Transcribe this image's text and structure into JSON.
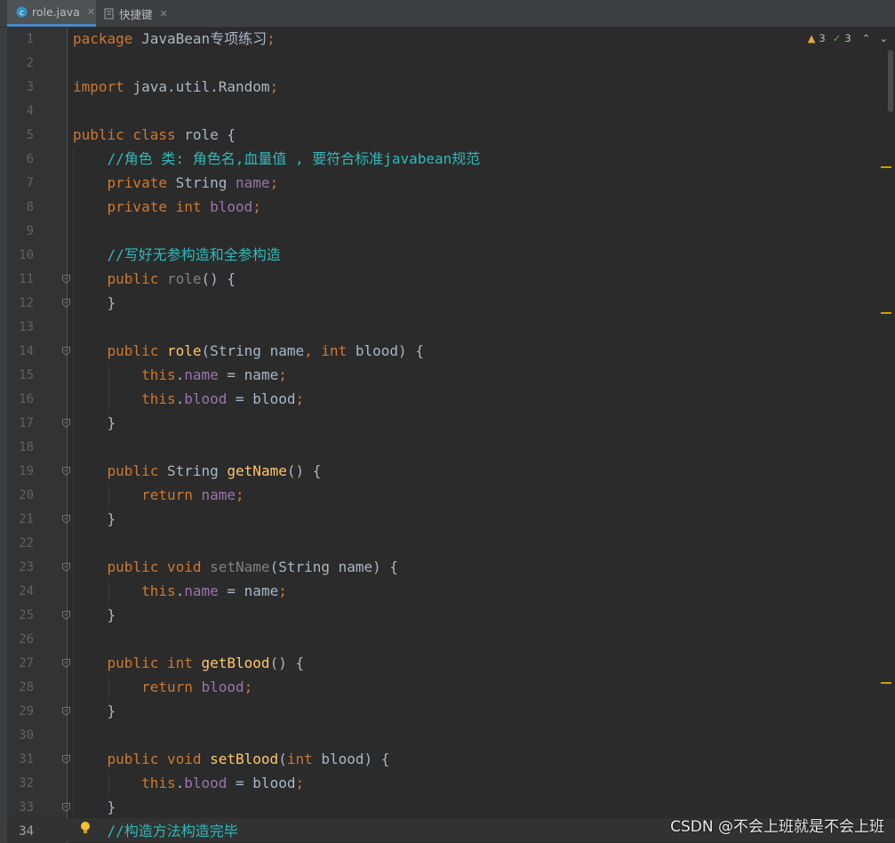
{
  "tabs": [
    {
      "label": "role.java",
      "icon": "java-class-icon",
      "active": true
    },
    {
      "label": "快捷键",
      "icon": "file-icon",
      "active": false
    }
  ],
  "inspections": {
    "warnings": "3",
    "weak_warnings": "3"
  },
  "current_line": 34,
  "code_lines": [
    {
      "n": 1,
      "tokens": [
        [
          "k",
          "package "
        ],
        [
          "p",
          "JavaBean专项练习"
        ],
        [
          "k",
          ";"
        ]
      ]
    },
    {
      "n": 2,
      "tokens": []
    },
    {
      "n": 3,
      "tokens": [
        [
          "k",
          "import "
        ],
        [
          "p",
          "java.util.Random"
        ],
        [
          "k",
          ";"
        ]
      ]
    },
    {
      "n": 4,
      "tokens": []
    },
    {
      "n": 5,
      "tokens": [
        [
          "k",
          "public class "
        ],
        [
          "p",
          "role {"
        ]
      ]
    },
    {
      "n": 6,
      "tokens": [
        [
          "p",
          "    "
        ],
        [
          "c",
          "//角色 类: 角色名,血量值 , 要符合标准javabean规范"
        ]
      ]
    },
    {
      "n": 7,
      "tokens": [
        [
          "p",
          "    "
        ],
        [
          "k",
          "private "
        ],
        [
          "p",
          "String "
        ],
        [
          "f",
          "name"
        ],
        [
          "k",
          ";"
        ]
      ]
    },
    {
      "n": 8,
      "tokens": [
        [
          "p",
          "    "
        ],
        [
          "k",
          "private int "
        ],
        [
          "f",
          "blood"
        ],
        [
          "k",
          ";"
        ]
      ]
    },
    {
      "n": 9,
      "tokens": []
    },
    {
      "n": 10,
      "tokens": [
        [
          "p",
          "    "
        ],
        [
          "c",
          "//写好无参构造和全参构造"
        ]
      ]
    },
    {
      "n": 11,
      "tokens": [
        [
          "p",
          "    "
        ],
        [
          "k",
          "public "
        ],
        [
          "g",
          "role"
        ],
        [
          "p",
          "() {"
        ]
      ]
    },
    {
      "n": 12,
      "tokens": [
        [
          "p",
          "    }"
        ]
      ]
    },
    {
      "n": 13,
      "tokens": []
    },
    {
      "n": 14,
      "tokens": [
        [
          "p",
          "    "
        ],
        [
          "k",
          "public "
        ],
        [
          "m",
          "role"
        ],
        [
          "p",
          "(String name"
        ],
        [
          "k",
          ", int "
        ],
        [
          "p",
          "blood) {"
        ]
      ]
    },
    {
      "n": 15,
      "tokens": [
        [
          "p",
          "        "
        ],
        [
          "k",
          "this"
        ],
        [
          "p",
          "."
        ],
        [
          "f",
          "name "
        ],
        [
          "p",
          "= name"
        ],
        [
          "k",
          ";"
        ]
      ]
    },
    {
      "n": 16,
      "tokens": [
        [
          "p",
          "        "
        ],
        [
          "k",
          "this"
        ],
        [
          "p",
          "."
        ],
        [
          "f",
          "blood "
        ],
        [
          "p",
          "= blood"
        ],
        [
          "k",
          ";"
        ]
      ]
    },
    {
      "n": 17,
      "tokens": [
        [
          "p",
          "    }"
        ]
      ]
    },
    {
      "n": 18,
      "tokens": []
    },
    {
      "n": 19,
      "tokens": [
        [
          "p",
          "    "
        ],
        [
          "k",
          "public "
        ],
        [
          "p",
          "String "
        ],
        [
          "m",
          "getName"
        ],
        [
          "p",
          "() {"
        ]
      ]
    },
    {
      "n": 20,
      "tokens": [
        [
          "p",
          "        "
        ],
        [
          "k",
          "return "
        ],
        [
          "f",
          "name"
        ],
        [
          "k",
          ";"
        ]
      ]
    },
    {
      "n": 21,
      "tokens": [
        [
          "p",
          "    }"
        ]
      ]
    },
    {
      "n": 22,
      "tokens": []
    },
    {
      "n": 23,
      "tokens": [
        [
          "p",
          "    "
        ],
        [
          "k",
          "public void "
        ],
        [
          "g",
          "setName"
        ],
        [
          "p",
          "(String name) {"
        ]
      ]
    },
    {
      "n": 24,
      "tokens": [
        [
          "p",
          "        "
        ],
        [
          "k",
          "this"
        ],
        [
          "p",
          "."
        ],
        [
          "f",
          "name "
        ],
        [
          "p",
          "= name"
        ],
        [
          "k",
          ";"
        ]
      ]
    },
    {
      "n": 25,
      "tokens": [
        [
          "p",
          "    }"
        ]
      ]
    },
    {
      "n": 26,
      "tokens": []
    },
    {
      "n": 27,
      "tokens": [
        [
          "p",
          "    "
        ],
        [
          "k",
          "public int "
        ],
        [
          "m",
          "getBlood"
        ],
        [
          "p",
          "() {"
        ]
      ]
    },
    {
      "n": 28,
      "tokens": [
        [
          "p",
          "        "
        ],
        [
          "k",
          "return "
        ],
        [
          "f",
          "blood"
        ],
        [
          "k",
          ";"
        ]
      ]
    },
    {
      "n": 29,
      "tokens": [
        [
          "p",
          "    }"
        ]
      ]
    },
    {
      "n": 30,
      "tokens": []
    },
    {
      "n": 31,
      "tokens": [
        [
          "p",
          "    "
        ],
        [
          "k",
          "public void "
        ],
        [
          "m",
          "setBlood"
        ],
        [
          "p",
          "("
        ],
        [
          "k",
          "int "
        ],
        [
          "p",
          "blood) {"
        ]
      ]
    },
    {
      "n": 32,
      "tokens": [
        [
          "p",
          "        "
        ],
        [
          "k",
          "this"
        ],
        [
          "p",
          "."
        ],
        [
          "f",
          "blood "
        ],
        [
          "p",
          "= blood"
        ],
        [
          "k",
          ";"
        ]
      ]
    },
    {
      "n": 33,
      "tokens": [
        [
          "p",
          "    }"
        ]
      ]
    },
    {
      "n": 34,
      "tokens": [
        [
          "p",
          "    "
        ],
        [
          "c",
          "//构造方法构造完毕"
        ]
      ]
    }
  ],
  "fold_lines": [
    11,
    12,
    14,
    17,
    19,
    21,
    23,
    25,
    27,
    29,
    31,
    33
  ],
  "watermark": "CSDN @不会上班就是不会上班",
  "colors": {
    "keyword": "#cc7832",
    "field": "#9876aa",
    "method": "#ffc66d",
    "comment": "#2fb9b9",
    "plain": "#a9b7c6",
    "background": "#2b2b2b",
    "tab_active_underline": "#4a88c7"
  }
}
